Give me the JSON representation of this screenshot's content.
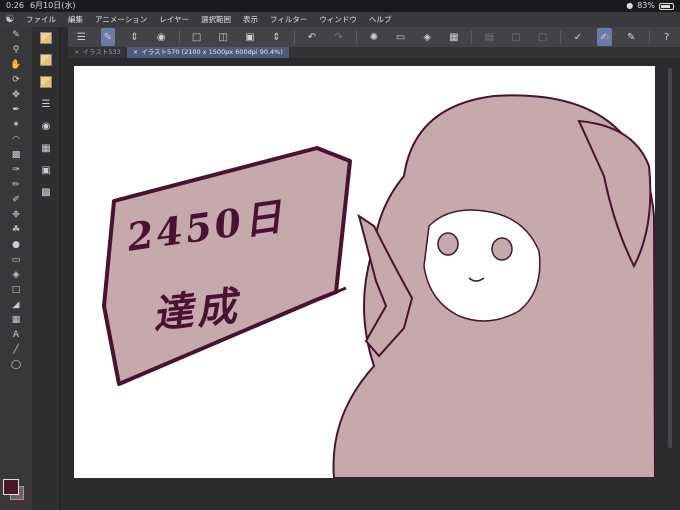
{
  "status_bar": {
    "time": "0:26",
    "date": "6月10日(水)",
    "battery": "83%",
    "battery_fraction": 0.83
  },
  "menu": {
    "items": [
      "ファイル",
      "編集",
      "アニメーション",
      "レイヤー",
      "選択範囲",
      "表示",
      "フィルター",
      "ウィンドウ",
      "ヘルプ"
    ]
  },
  "tabs": [
    {
      "label": "イラスト533",
      "active": false
    },
    {
      "label": "イラスト570 (2100 x 1500px 600dpi 90.4%)",
      "active": true
    }
  ],
  "canvas": {
    "background": "#ffffff",
    "line_color": "#4a1230",
    "fill_color": "#c6a9ad",
    "text_line1": "2450日",
    "text_line2": "達成"
  },
  "color": {
    "main": "#4a1728",
    "sub": "#7a5b6a"
  },
  "icons": {
    "cmd": [
      "menu-icon",
      "brush-icon",
      "stepper-icon",
      "bubble-icon",
      "new-icon",
      "open-icon",
      "save-icon",
      "stepper-icon",
      "undo-icon",
      "redo-icon",
      "spinner-icon",
      "fill-icon",
      "transform-icon",
      "clear-icon",
      "mesh-icon",
      "frame-icon",
      "ruler-icon",
      "pen-ruler-icon",
      "stroke-icon",
      "help-icon"
    ]
  }
}
